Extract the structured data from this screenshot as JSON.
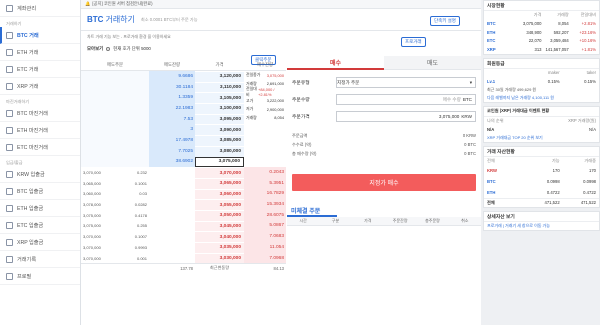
{
  "sidebar": {
    "items": [
      {
        "label": "계좌관리",
        "active": false
      },
      {
        "section": "거래하기"
      },
      {
        "label": "BTC 거래",
        "active": true
      },
      {
        "label": "ETH 거래",
        "active": false
      },
      {
        "label": "ETC 거래",
        "active": false
      },
      {
        "label": "XRP 거래",
        "active": false
      },
      {
        "section": "마진거래하기"
      },
      {
        "label": "BTC 마진거래",
        "active": false
      },
      {
        "label": "ETH 마진거래",
        "active": false
      },
      {
        "label": "ETC 마진거래",
        "active": false
      },
      {
        "section": "입금/출금"
      },
      {
        "label": "KRW 입출금",
        "active": false
      },
      {
        "label": "BTC 입출금",
        "active": false
      },
      {
        "label": "ETH 입출금",
        "active": false
      },
      {
        "label": "ETC 입출금",
        "active": false
      },
      {
        "label": "XRP 입출금",
        "active": false
      },
      {
        "label": "거래기록",
        "active": false
      },
      {
        "label": "프로필",
        "active": false
      }
    ]
  },
  "notice": {
    "icon": "bell-icon",
    "text": "[공지] 코인원 서버 점검안내(완료)"
  },
  "title": {
    "coin": "BTC",
    "label": "거래하기",
    "sub": "최소 0.0001 BTC부터 주문 가능"
  },
  "title_buttons": {
    "guide": "단축키 설명",
    "pro": "프로거래"
  },
  "toolbar": {
    "desc": "차트 거래 기능 보는 - 프로거래 환경 을 이용하세요",
    "pro_link": "프로거래",
    "group_label": "모아보기",
    "group_value": "현재 호가 단위 5000",
    "click_order": "클릭주문"
  },
  "orderbook": {
    "headers": [
      "매도주문",
      "매도잔량",
      "가격",
      "매수잔량"
    ],
    "asks": [
      {
        "qty": "9.6686",
        "price": "3,120,000"
      },
      {
        "qty": "30.1184",
        "price": "3,110,000"
      },
      {
        "qty": "1.3359",
        "price": "3,105,000"
      },
      {
        "qty": "22.1983",
        "price": "3,100,000"
      },
      {
        "qty": "7.53",
        "price": "3,095,000"
      },
      {
        "qty": "3",
        "price": "3,090,000"
      },
      {
        "qty": "17.4978",
        "price": "3,085,000"
      },
      {
        "qty": "7.7025",
        "price": "3,080,000"
      },
      {
        "qty": "38.6902",
        "price": "3,075,000"
      }
    ],
    "bids": [
      {
        "price": "3,070,000",
        "qty": "0.2043",
        "mine": "3,070,000",
        "mine_qty": "0.232"
      },
      {
        "price": "3,065,000",
        "qty": "5.3951",
        "mine": "3,065,000",
        "mine_qty": "0.1001"
      },
      {
        "price": "3,060,000",
        "qty": "16.7829",
        "mine": "3,060,000",
        "mine_qty": "0.03"
      },
      {
        "price": "3,055,000",
        "qty": "15.3934",
        "mine": "3,078,000",
        "mine_qty": "0.0282"
      },
      {
        "price": "3,050,000",
        "qty": "28.6075",
        "mine": "3,075,000",
        "mine_qty": "0.4178"
      },
      {
        "price": "3,045,000",
        "qty": "5.0867",
        "mine": "3,075,000",
        "mine_qty": "0.255"
      },
      {
        "price": "3,040,000",
        "qty": "7.0683",
        "mine": "3,070,000",
        "mine_qty": "0.1007"
      },
      {
        "price": "3,035,000",
        "qty": "11.054",
        "mine": "3,070,000",
        "mine_qty": "0.9993"
      },
      {
        "price": "3,030,000",
        "qty": "7.0968",
        "mine": "3,070,000",
        "mine_qty": "0.001"
      }
    ],
    "footer": {
      "left": "137.78",
      "label": "최근변동량",
      "right": "84.13"
    }
  },
  "market_info": {
    "rows": [
      {
        "k": "전일종가",
        "v": "3,075,000"
      },
      {
        "k": "거래량",
        "v": "2,691,000"
      },
      {
        "k": "전일대비",
        "v": "+84,000 / +2.81%"
      },
      {
        "k": "고가",
        "v": "3,222,000"
      },
      {
        "k": "저가",
        "v": "2,900,000"
      },
      {
        "k": "거래량",
        "v": "8,054"
      }
    ]
  },
  "order": {
    "tabs": [
      "매수",
      "매도"
    ],
    "type_label": "주문유형",
    "type_value": "지정가 주문",
    "qty_label": "주문수량",
    "qty_placeholder": "매수 수량",
    "qty_unit": "BTC",
    "price_label": "주문가격",
    "price_value": "3,075,000",
    "price_unit": "KRW",
    "totals": [
      {
        "k": "주문금액",
        "v": "0 KRW"
      },
      {
        "k": "수수료 (약)",
        "v": "0 BTC"
      },
      {
        "k": "총 매수량 (약)",
        "v": "0 BTC"
      }
    ],
    "submit": "지정가 매수"
  },
  "unfilled": {
    "title": "미체결 주문",
    "headers": [
      "시간",
      "구분",
      "가격",
      "주문잔량",
      "총주문량",
      "취소"
    ]
  },
  "right": {
    "market_title": "시장현황",
    "market_headers": [
      "",
      "가격",
      "거래량",
      "전일대비"
    ],
    "market_rows": [
      {
        "c": "BTC",
        "p": "3,075,000",
        "v": "8,054",
        "ch": "+2.81%"
      },
      {
        "c": "ETH",
        "p": "348,900",
        "v": "592,207",
        "ch": "+23.16%"
      },
      {
        "c": "ETC",
        "p": "22,070",
        "v": "3,059,484",
        "ch": "+10.16%"
      },
      {
        "c": "XRP",
        "p": "313",
        "v": "141,567,057",
        "ch": "+1.81%"
      }
    ],
    "fee_title": "회원등급",
    "fee_headers": [
      "",
      "maker",
      "taker"
    ],
    "fee_row": {
      "lv": "Lv.1",
      "maker": "0.15%",
      "taker": "0.15%"
    },
    "fee_note": "최근 30일 거래량 499,629 원",
    "fee_note2": "다음 레벨까지 남은 거래량 4,100,111 원",
    "ad_title": "코인원 (XRP) 거래대금 이벤트 현황",
    "ad_row": [
      {
        "k": "나의 순위",
        "v": "N/A"
      },
      {
        "k": "XRP 거래량(원)",
        "v": "N/A"
      }
    ],
    "ad_note": "XRP 거래대금 TOP 20 순위 보기",
    "asset_title": "거래 자산현황",
    "asset_headers": [
      "전체",
      "가능",
      "거래중"
    ],
    "assets": [
      {
        "c": "KRW",
        "total": "170",
        "avail": "170"
      },
      {
        "c": "BTC",
        "total": "0.0998",
        "avail": "0.0998"
      },
      {
        "c": "ETH",
        "total": "0.4722",
        "avail": "0.4722"
      }
    ],
    "asset_total_label": "전체",
    "asset_total": "471,522",
    "asset_total2": "471,522",
    "detail_link": "상세자산 보기",
    "pro_note": "프로거래 | 거래기 새 창으로 이동 가능"
  }
}
